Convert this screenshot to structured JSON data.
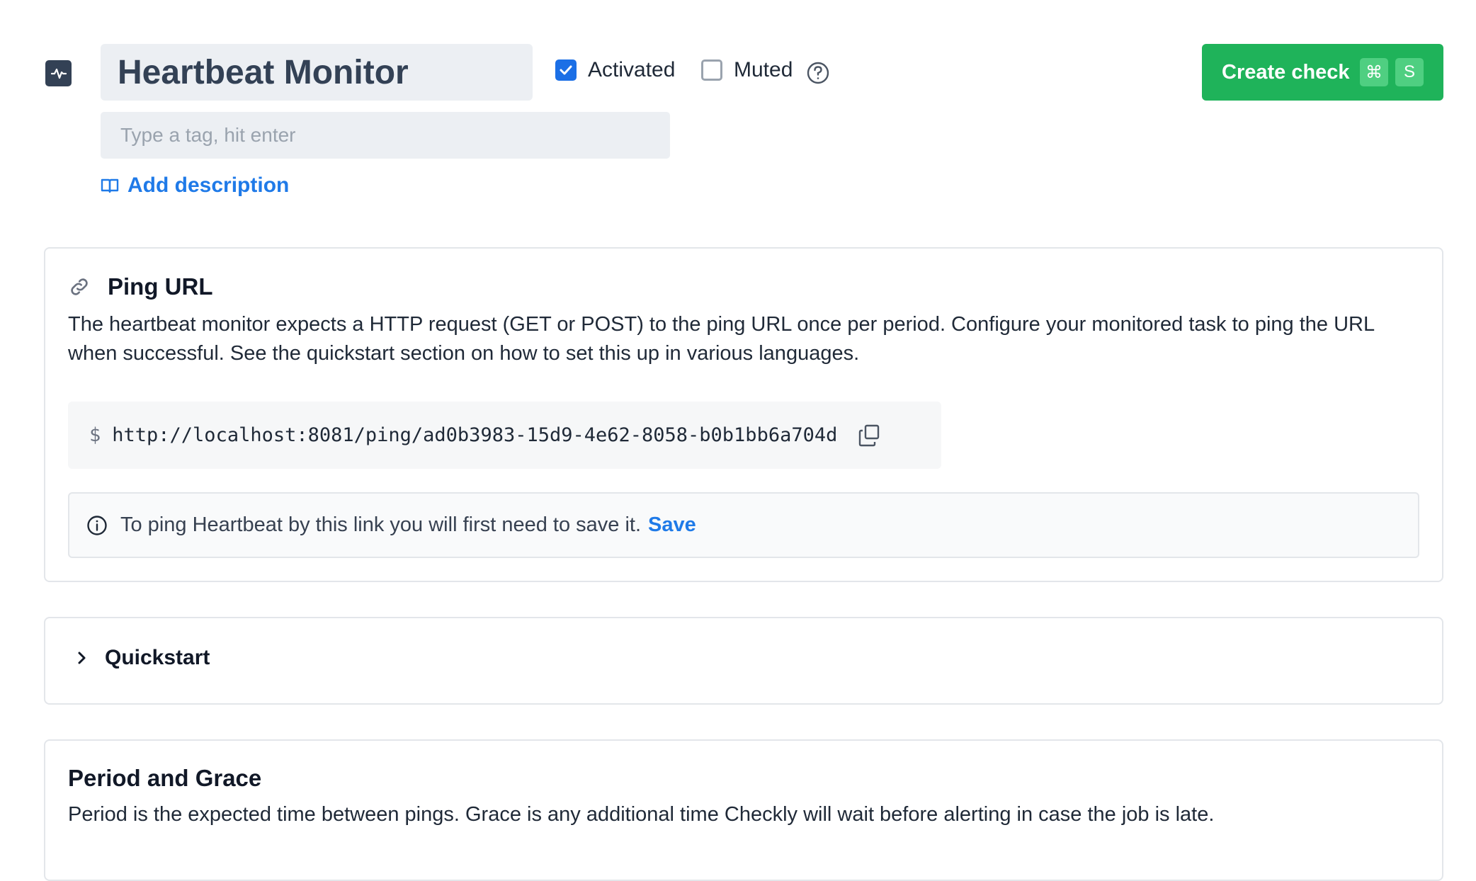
{
  "header": {
    "check_type_icon": "heartbeat-icon",
    "check_name": "Heartbeat Monitor",
    "tag_placeholder": "Type a tag, hit enter",
    "add_description_label": "Add description",
    "activated": {
      "label": "Activated",
      "checked": true
    },
    "muted": {
      "label": "Muted",
      "checked": false
    },
    "create_button": {
      "label": "Create check",
      "shortcut_keys": [
        "⌘",
        "S"
      ]
    }
  },
  "ping_url": {
    "title": "Ping URL",
    "description": "The heartbeat monitor expects a HTTP request (GET or POST) to the ping URL once per period. Configure your monitored task to ping the URL when successful. See the quickstart section on how to set this up in various languages.",
    "prompt": "$",
    "url": "http://localhost:8081/ping/ad0b3983-15d9-4e62-8058-b0b1bb6a704d",
    "notice_text": "To ping Heartbeat by this link you will first need to save it.",
    "notice_action": "Save"
  },
  "quickstart": {
    "title": "Quickstart",
    "expanded": false
  },
  "period_grace": {
    "title": "Period and Grace",
    "description": "Period is the expected time between pings. Grace is any additional time Checkly will wait before alerting in case the job is late."
  },
  "colors": {
    "accent_blue": "#1f7ae8",
    "checkbox_blue": "#1b6fe6",
    "create_green": "#1fb35a",
    "icon_dark": "#334155"
  }
}
